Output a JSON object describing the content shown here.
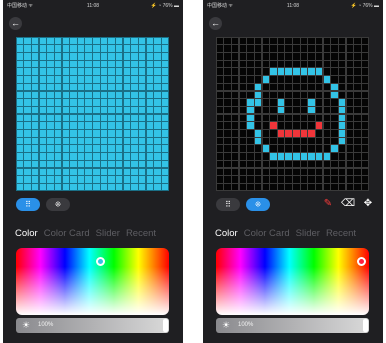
{
  "status_bar": {
    "carrier": "中国移动 ᯤ",
    "time": "11:08",
    "right": "⚡ ◔ 76% ▬"
  },
  "nav": {
    "back_glyph": "←"
  },
  "tabs": [
    "Color",
    "Color Card",
    "Slider",
    "Recent"
  ],
  "mode_buttons": {
    "grid_glyph": "⠿",
    "dots_glyph": "⁜"
  },
  "tools": {
    "pencil": "✎",
    "eraser": "⌫",
    "move": "✥"
  },
  "brightness": {
    "value_label": "100%",
    "sun_glyph": "☀"
  },
  "colors": {
    "pixel_blue": "#33c3e6",
    "smile_red": "#f0353a",
    "canvas_off": "#050505",
    "grid_line": "#3a3a3a",
    "accent": "#2a90e8",
    "phone_bg": "#1f1f22"
  },
  "screens": [
    {
      "active_mode": "grid",
      "show_tools": false,
      "active_tab": 0,
      "picker_thumb": {
        "hue_fraction": 0.55,
        "whiteness_fraction": 0.13,
        "color": "#33c3e6"
      },
      "brightness_fraction": 1.0,
      "grid": {
        "size": 20,
        "fill": "all"
      }
    },
    {
      "active_mode": "dots",
      "show_tools": true,
      "active_tab": 0,
      "picker_thumb": {
        "hue_fraction": 0.95,
        "whiteness_fraction": 0.13,
        "color": "#ff2040"
      },
      "brightness_fraction": 1.0,
      "grid": {
        "size": 20,
        "fill": "pattern",
        "blue_pixels": [
          [
            4,
            7
          ],
          [
            4,
            8
          ],
          [
            4,
            9
          ],
          [
            4,
            10
          ],
          [
            4,
            11
          ],
          [
            4,
            12
          ],
          [
            4,
            13
          ],
          [
            5,
            6
          ],
          [
            5,
            14
          ],
          [
            6,
            5
          ],
          [
            6,
            15
          ],
          [
            7,
            5
          ],
          [
            7,
            15
          ],
          [
            8,
            4
          ],
          [
            8,
            5
          ],
          [
            8,
            16
          ],
          [
            9,
            4
          ],
          [
            9,
            16
          ],
          [
            10,
            4
          ],
          [
            10,
            16
          ],
          [
            11,
            4
          ],
          [
            11,
            16
          ],
          [
            12,
            5
          ],
          [
            12,
            16
          ],
          [
            13,
            5
          ],
          [
            13,
            16
          ],
          [
            14,
            6
          ],
          [
            14,
            15
          ],
          [
            15,
            7
          ],
          [
            15,
            8
          ],
          [
            15,
            9
          ],
          [
            15,
            10
          ],
          [
            15,
            11
          ],
          [
            15,
            12
          ],
          [
            15,
            13
          ],
          [
            15,
            14
          ],
          [
            8,
            8
          ],
          [
            8,
            12
          ],
          [
            9,
            8
          ],
          [
            9,
            12
          ]
        ],
        "red_pixels": [
          [
            11,
            7
          ],
          [
            11,
            13
          ],
          [
            12,
            8
          ],
          [
            12,
            9
          ],
          [
            12,
            10
          ],
          [
            12,
            11
          ],
          [
            12,
            12
          ]
        ]
      }
    }
  ]
}
